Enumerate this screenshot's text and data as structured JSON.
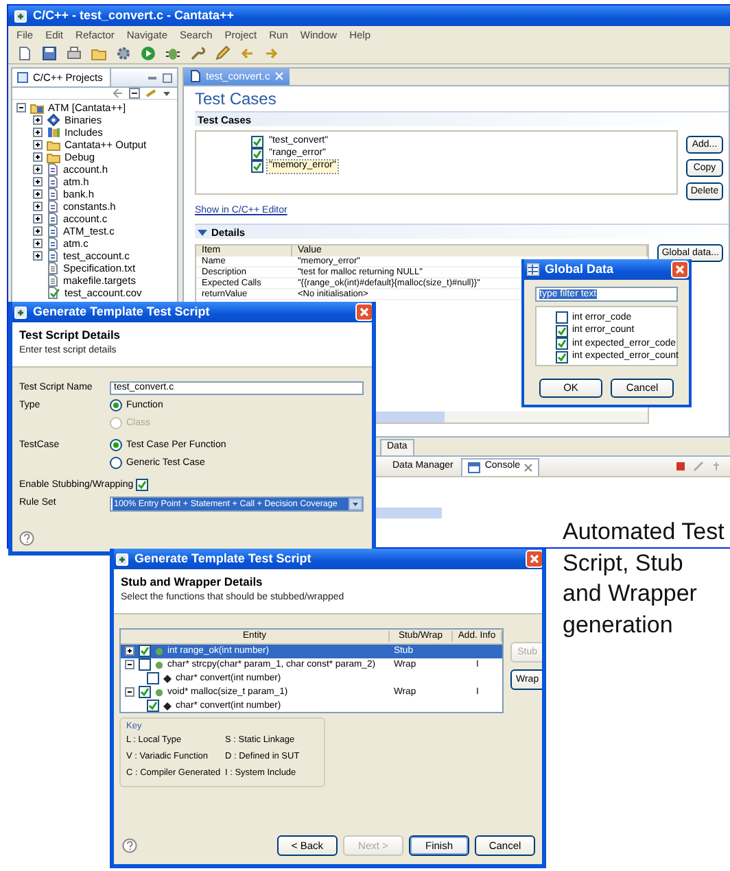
{
  "ide_window": {
    "title": "C/C++ - test_convert.c - Cantata++",
    "menu": [
      "File",
      "Edit",
      "Refactor",
      "Navigate",
      "Search",
      "Project",
      "Run",
      "Window",
      "Help"
    ],
    "project_explorer": {
      "tab": "C/C++ Projects",
      "tree": [
        {
          "label": "ATM [Cantata++]",
          "kind": "project",
          "expanded": true,
          "children": [
            {
              "label": "Binaries",
              "kind": "binaries",
              "expanded": false
            },
            {
              "label": "Includes",
              "kind": "includes",
              "expanded": false
            },
            {
              "label": "Cantata++ Output",
              "kind": "folder",
              "expanded": false
            },
            {
              "label": "Debug",
              "kind": "folder",
              "expanded": false
            },
            {
              "label": "account.h",
              "kind": "header",
              "expanded": false
            },
            {
              "label": "atm.h",
              "kind": "header",
              "expanded": false
            },
            {
              "label": "bank.h",
              "kind": "header",
              "expanded": false
            },
            {
              "label": "constants.h",
              "kind": "header",
              "expanded": false
            },
            {
              "label": "account.c",
              "kind": "source",
              "expanded": false
            },
            {
              "label": "ATM_test.c",
              "kind": "source",
              "expanded": false
            },
            {
              "label": "atm.c",
              "kind": "source",
              "expanded": false
            },
            {
              "label": "test_account.c",
              "kind": "source",
              "expanded": false
            },
            {
              "label": "Specification.txt",
              "kind": "text"
            },
            {
              "label": "makefile.targets",
              "kind": "text"
            },
            {
              "label": "test_account.cov",
              "kind": "coverage"
            }
          ]
        }
      ]
    },
    "editor_tab": "test_convert.c",
    "editor": {
      "heading": "Test Cases",
      "test_cases": {
        "title": "Test Cases",
        "items": [
          {
            "label": "\"test_convert\"",
            "checked": true,
            "selected": false
          },
          {
            "label": "\"range_error\"",
            "checked": true,
            "selected": false
          },
          {
            "label": "\"memory_error\"",
            "checked": true,
            "selected": true
          }
        ],
        "buttons": [
          "Add...",
          "Copy",
          "Delete"
        ]
      },
      "link": "Show in C/C++ Editor",
      "details": {
        "title": "Details",
        "expanded": true,
        "columns": [
          "Item",
          "Value"
        ],
        "rows": [
          [
            "Name",
            "\"memory_error\""
          ],
          [
            "Description",
            "\"test for malloc returning NULL\""
          ],
          [
            "Expected Calls",
            "\"{{range_ok(int)#default}{malloc(size_t)#null}}\""
          ],
          [
            "returnValue",
            "<No initialisation>"
          ]
        ],
        "button": "Global data..."
      }
    },
    "bottom_tab": "Data",
    "view_tabs": [
      {
        "label": "Data Manager",
        "selected": false
      },
      {
        "label": "Console",
        "selected": true
      }
    ]
  },
  "global_data_dialog": {
    "title": "Global Data",
    "filter": "type filter text",
    "items": [
      {
        "label": "int error_code",
        "checked": false
      },
      {
        "label": "int error_count",
        "checked": true
      },
      {
        "label": "int expected_error_code",
        "checked": true
      },
      {
        "label": "int expected_error_count",
        "checked": true
      }
    ],
    "buttons": [
      "OK",
      "Cancel"
    ]
  },
  "script_dialog": {
    "title": "Generate Template Test Script",
    "heading": "Test Script Details",
    "subtitle": "Enter test script details",
    "fields": [
      {
        "kind": "text",
        "label": "Test Script Name",
        "value": "test_convert.c"
      },
      {
        "kind": "radio",
        "label": "Type",
        "options": [
          {
            "label": "Function",
            "selected": true,
            "disabled": false
          },
          {
            "label": "Class",
            "selected": false,
            "disabled": true
          }
        ]
      },
      {
        "kind": "radio",
        "label": "TestCase",
        "options": [
          {
            "label": "Test Case Per Function",
            "selected": true,
            "disabled": false
          },
          {
            "label": "Generic Test Case",
            "selected": false,
            "disabled": false
          }
        ]
      },
      {
        "kind": "checkbox",
        "label": "Enable Stubbing/Wrapping",
        "checked": true
      },
      {
        "kind": "dropdown",
        "label": "Rule Set",
        "value": "100% Entry Point + Statement + Call + Decision Coverage"
      }
    ]
  },
  "stub_dialog": {
    "title": "Generate Template Test Script",
    "heading": "Stub and Wrapper Details",
    "subtitle": "Select the functions that should be stubbed/wrapped",
    "columns": [
      "Entity",
      "Stub/Wrap",
      "Add. Info"
    ],
    "rows": [
      {
        "entity": "int range_ok(int number)",
        "kind": "function",
        "checked": true,
        "selected": true,
        "expanded": false,
        "stub_wrap": "Stub"
      },
      {
        "entity": "char* strcpy(char* param_1, char const* param_2)",
        "kind": "function",
        "checked": false,
        "selected": false,
        "expanded": true,
        "stub_wrap": "Wrap",
        "add_info": "I",
        "children": [
          {
            "entity": "char* convert(int number)",
            "kind": "caller",
            "checked": false,
            "selected": false
          }
        ]
      },
      {
        "entity": "void* malloc(size_t param_1)",
        "kind": "function",
        "checked": true,
        "selected": false,
        "expanded": true,
        "stub_wrap": "Wrap",
        "add_info": "I",
        "children": [
          {
            "entity": "char* convert(int number)",
            "kind": "caller",
            "checked": true,
            "selected": false
          }
        ]
      }
    ],
    "side_buttons": [
      {
        "label": "Stub",
        "disabled": true
      },
      {
        "label": "Wrap",
        "disabled": false
      }
    ],
    "key_title": "Key",
    "key": [
      "L : Local Type",
      "S : Static Linkage",
      "V : Variadic Function",
      "D : Defined in SUT",
      "C : Compiler Generated",
      "I : System Include"
    ],
    "buttons": [
      {
        "label": "< Back",
        "disabled": false,
        "default": false
      },
      {
        "label": "Next >",
        "disabled": true,
        "default": false
      },
      {
        "label": "Finish",
        "disabled": false,
        "default": true
      },
      {
        "label": "Cancel",
        "disabled": false,
        "default": false
      }
    ]
  },
  "caption": "Automated Test Script, Stub and Wrapper generation"
}
